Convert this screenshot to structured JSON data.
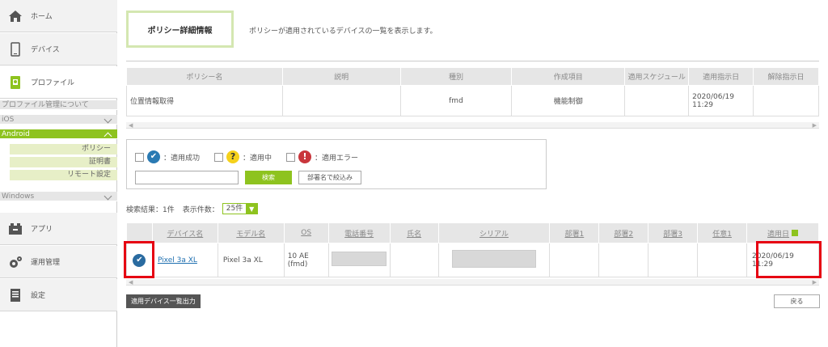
{
  "sidebar": {
    "home": "ホーム",
    "device": "デバイス",
    "profile": "プロファイル",
    "profile_about": "プロファイル管理について",
    "ios": "iOS",
    "android": "Android",
    "policy": "ポリシー",
    "certificate": "証明書",
    "remote": "リモート設定",
    "windows": "Windows",
    "apps": "アプリ",
    "operations": "運用管理",
    "settings": "設定"
  },
  "header": {
    "tab_title": "ポリシー詳細情報",
    "description": "ポリシーが適用されているデバイスの一覧を表示します。"
  },
  "policy_table": {
    "headers": [
      "ポリシー名",
      "説明",
      "種別",
      "作成項目",
      "適用スケジュール",
      "適用指示日",
      "解除指示日"
    ],
    "row": [
      "位置情報取得",
      "",
      "fmd",
      "機能制御",
      "",
      "2020/06/19 11:29",
      ""
    ]
  },
  "filter": {
    "success": "：適用成功",
    "pending": "：適用中",
    "error": "：適用エラー",
    "search_placeholder": "",
    "search_button": "検索",
    "dept_button": "部署名で絞込み"
  },
  "results": {
    "count_label": "検索結果：1件",
    "per_page_label": "表示件数：",
    "per_page_value": "25件"
  },
  "device_table": {
    "headers": [
      "デバイス名",
      "モデル名",
      "OS",
      "電話番号",
      "氏名",
      "シリアル",
      "部署1",
      "部署2",
      "部署3",
      "任意1",
      "適用日"
    ],
    "row": {
      "device_name": "Pixel 3a XL",
      "model": "Pixel 3a XL",
      "os_line1": "10 AE",
      "os_line2": "(fmd)",
      "applied_date": "2020/06/19",
      "applied_time": "11:29"
    }
  },
  "footer": {
    "export_button": "適用デバイス一覧出力",
    "back_button": "戻る"
  },
  "colors": {
    "accent": "#8ec31f",
    "highlight": "#e60012",
    "link": "#1e6fb0"
  }
}
